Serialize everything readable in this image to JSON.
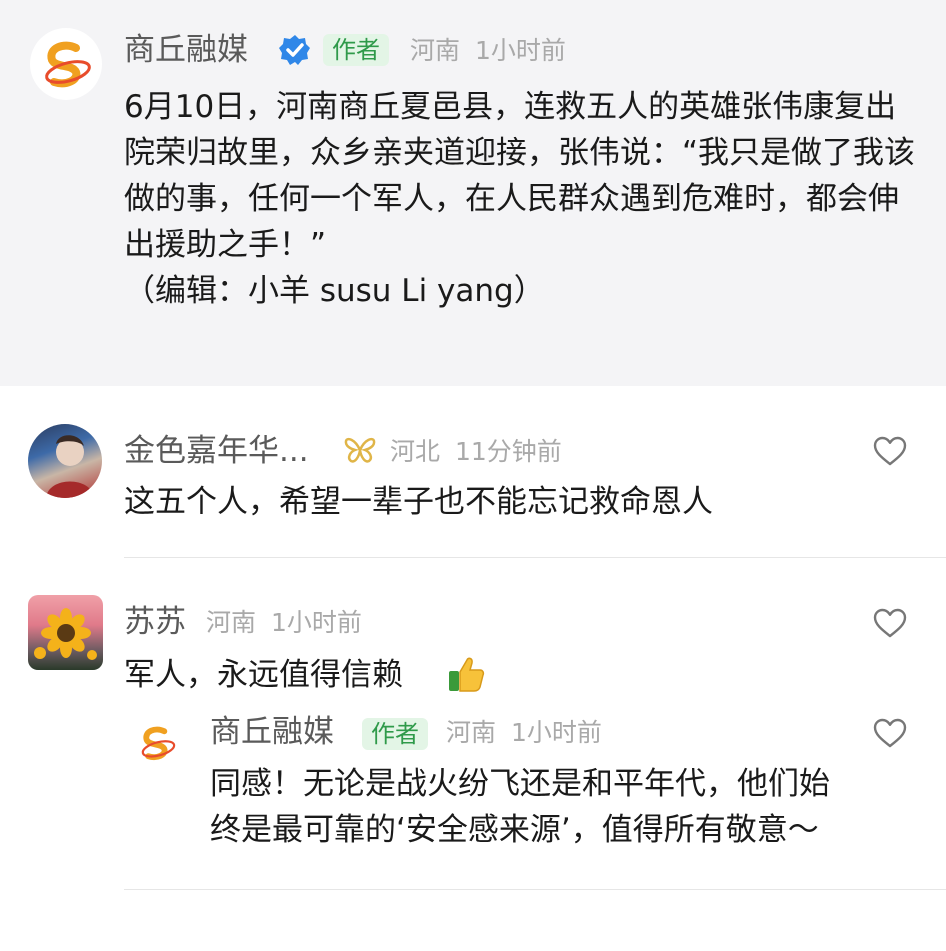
{
  "post": {
    "author": "商丘融媒",
    "badge": "作者",
    "location": "河南",
    "time": "1小时前",
    "text": "6月10日，河南商丘夏邑县，连救五人的英雄张伟康复出院荣归故里，众乡亲夹道迎接，张伟说：“我只是做了我该做的事，任何一个军人，在人民群众遇到危难时，都会伸出援助之手！”\n（编辑：小羊 susu Li  yang）"
  },
  "comments": [
    {
      "author": "金色嘉年华...",
      "badge_icon": "butterfly-icon",
      "location": "河北",
      "time": "11分钟前",
      "text": "这五个人，希望一辈子也不能忘记救命恩人"
    },
    {
      "author": "苏苏",
      "location": "河南",
      "time": "1小时前",
      "text": "军人，永远值得信赖",
      "emoji_icon": "thumbs-up-icon",
      "reply": {
        "author": "商丘融媒",
        "badge": "作者",
        "location": "河南",
        "time": "1小时前",
        "text_line1": "同感！无论是战火纷飞还是和平年代，他们始",
        "text_line2": "终是最可靠的‘安全感来源’，值得所有敬意～"
      }
    }
  ],
  "colors": {
    "post_background": "#f4f4f6",
    "badge_green": "#2f9a4a",
    "badge_bg": "#e3f5e6",
    "verified_blue": "#2f87e8",
    "logo_orange": "#f0a020"
  }
}
